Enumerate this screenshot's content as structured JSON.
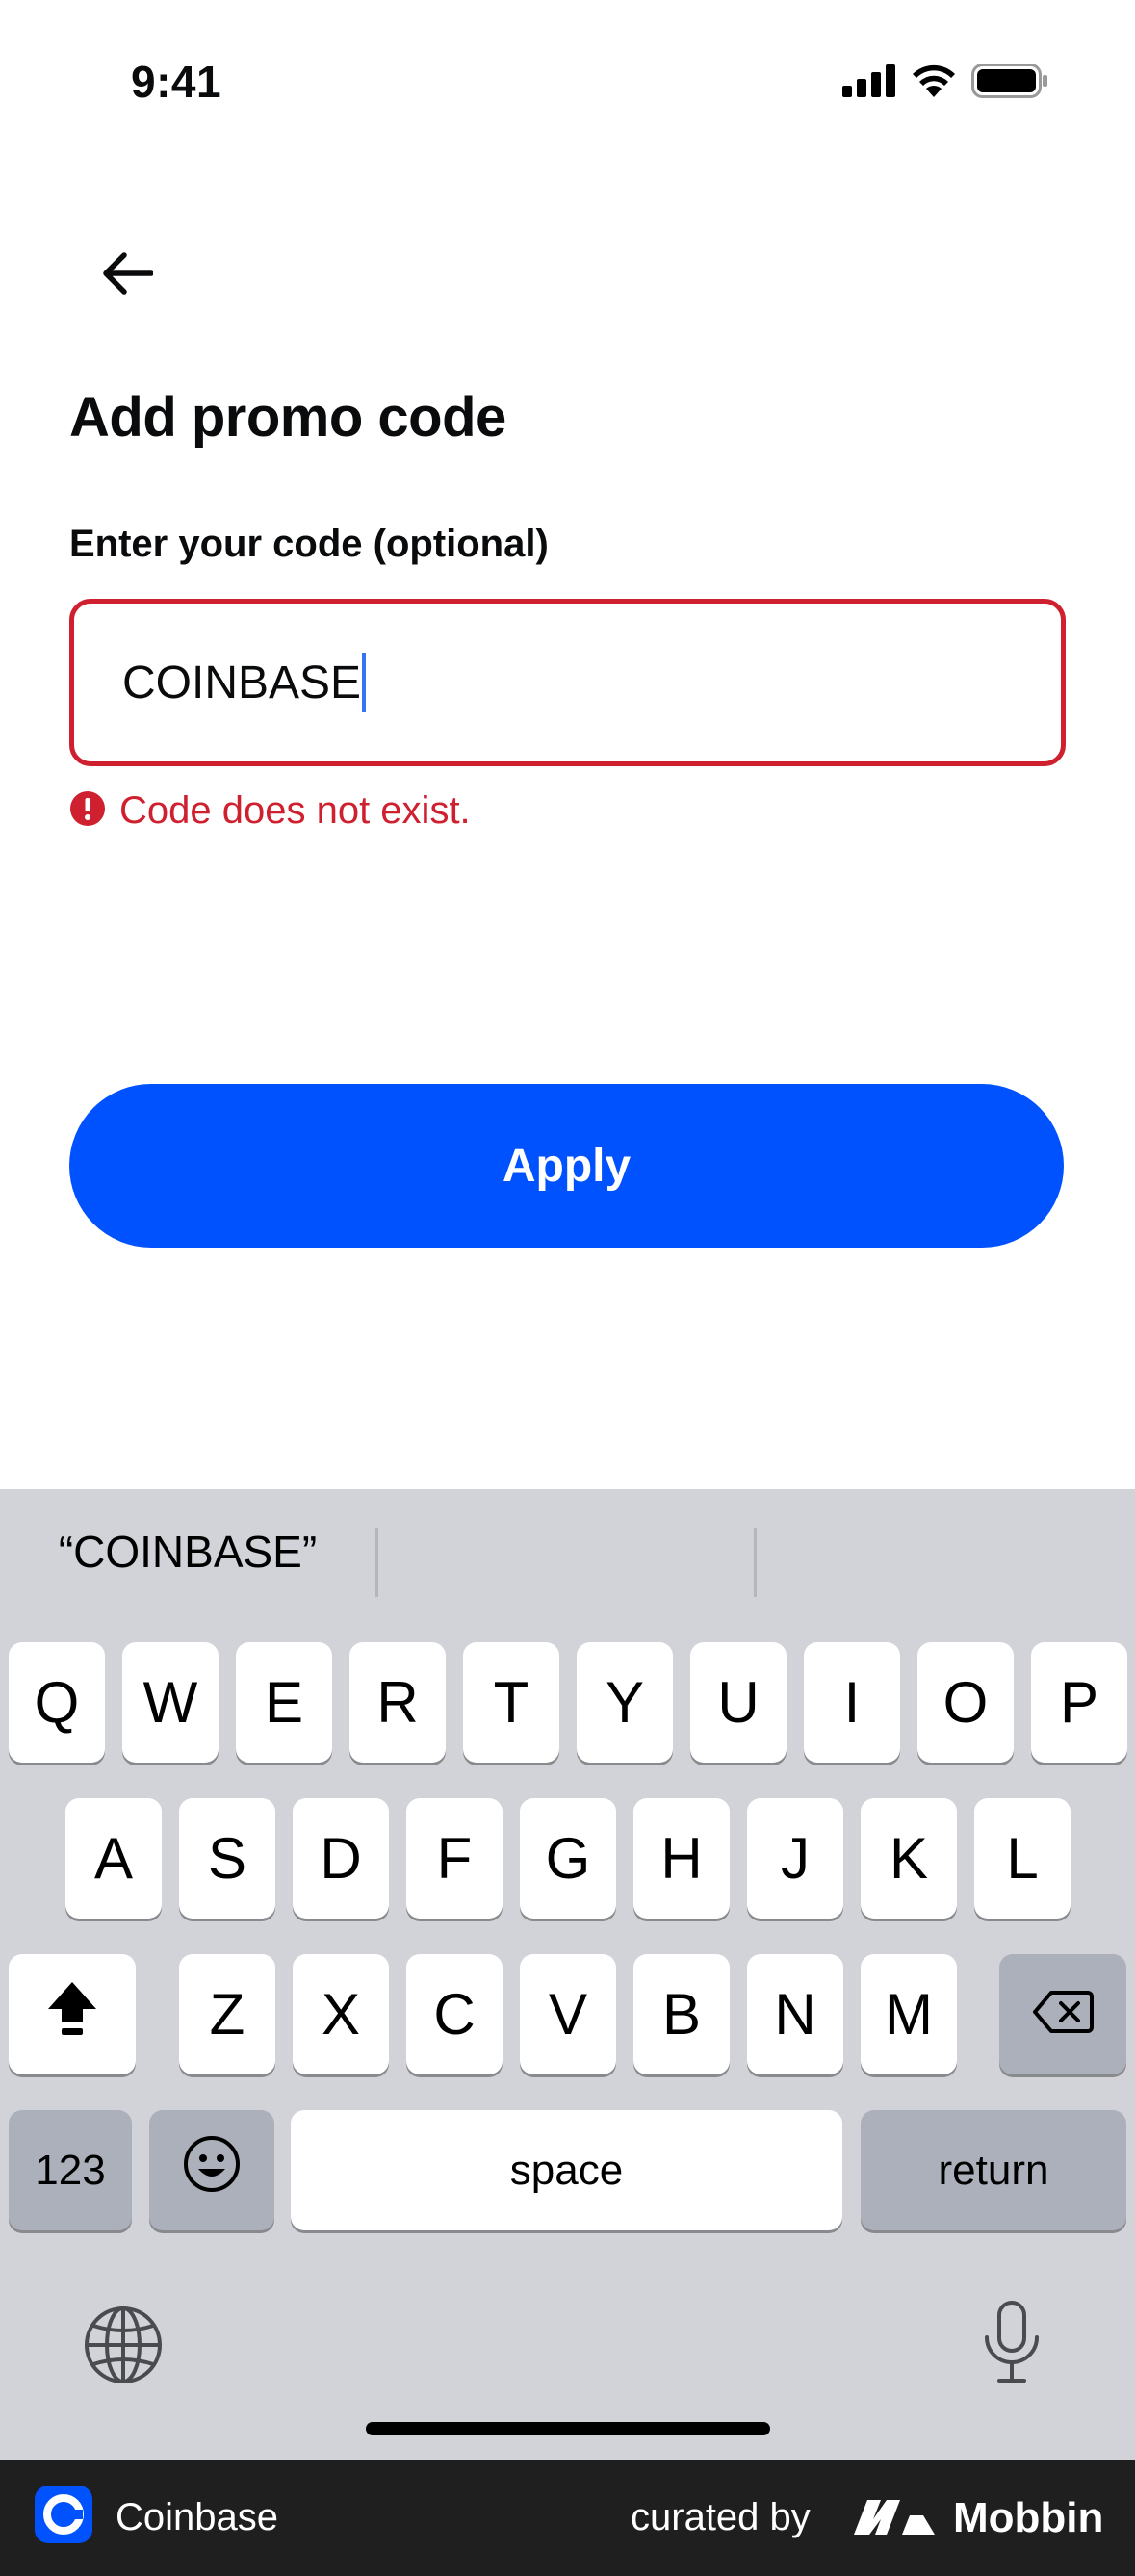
{
  "status_bar": {
    "time": "9:41",
    "icons": [
      "cellular-signal-icon",
      "wifi-icon",
      "battery-icon"
    ]
  },
  "header": {
    "back_icon": "arrow-left-icon"
  },
  "page": {
    "title": "Add promo code",
    "field_label": "Enter your code (optional)",
    "code_value": "COINBASE",
    "error_icon": "error-circle-icon",
    "error_text": "Code does not exist.",
    "apply_label": "Apply"
  },
  "keyboard": {
    "suggestions": [
      "“COINBASE”",
      "",
      ""
    ],
    "row1": [
      "Q",
      "W",
      "E",
      "R",
      "T",
      "Y",
      "U",
      "I",
      "O",
      "P"
    ],
    "row2": [
      "A",
      "S",
      "D",
      "F",
      "G",
      "H",
      "J",
      "K",
      "L"
    ],
    "row3": [
      "Z",
      "X",
      "C",
      "V",
      "B",
      "N",
      "M"
    ],
    "numbers_label": "123",
    "space_label": "space",
    "return_label": "return",
    "icons": [
      "shift-icon",
      "backspace-icon",
      "emoji-icon",
      "globe-icon",
      "microphone-icon"
    ]
  },
  "footer": {
    "app_name": "Coinbase",
    "curated_by": "curated by",
    "brand": "Mobbin"
  },
  "colors": {
    "accent": "#0052ff",
    "error": "#cf202f",
    "keyboard_bg": "#d1d3d9",
    "footer_bg": "#1f1f1f"
  }
}
